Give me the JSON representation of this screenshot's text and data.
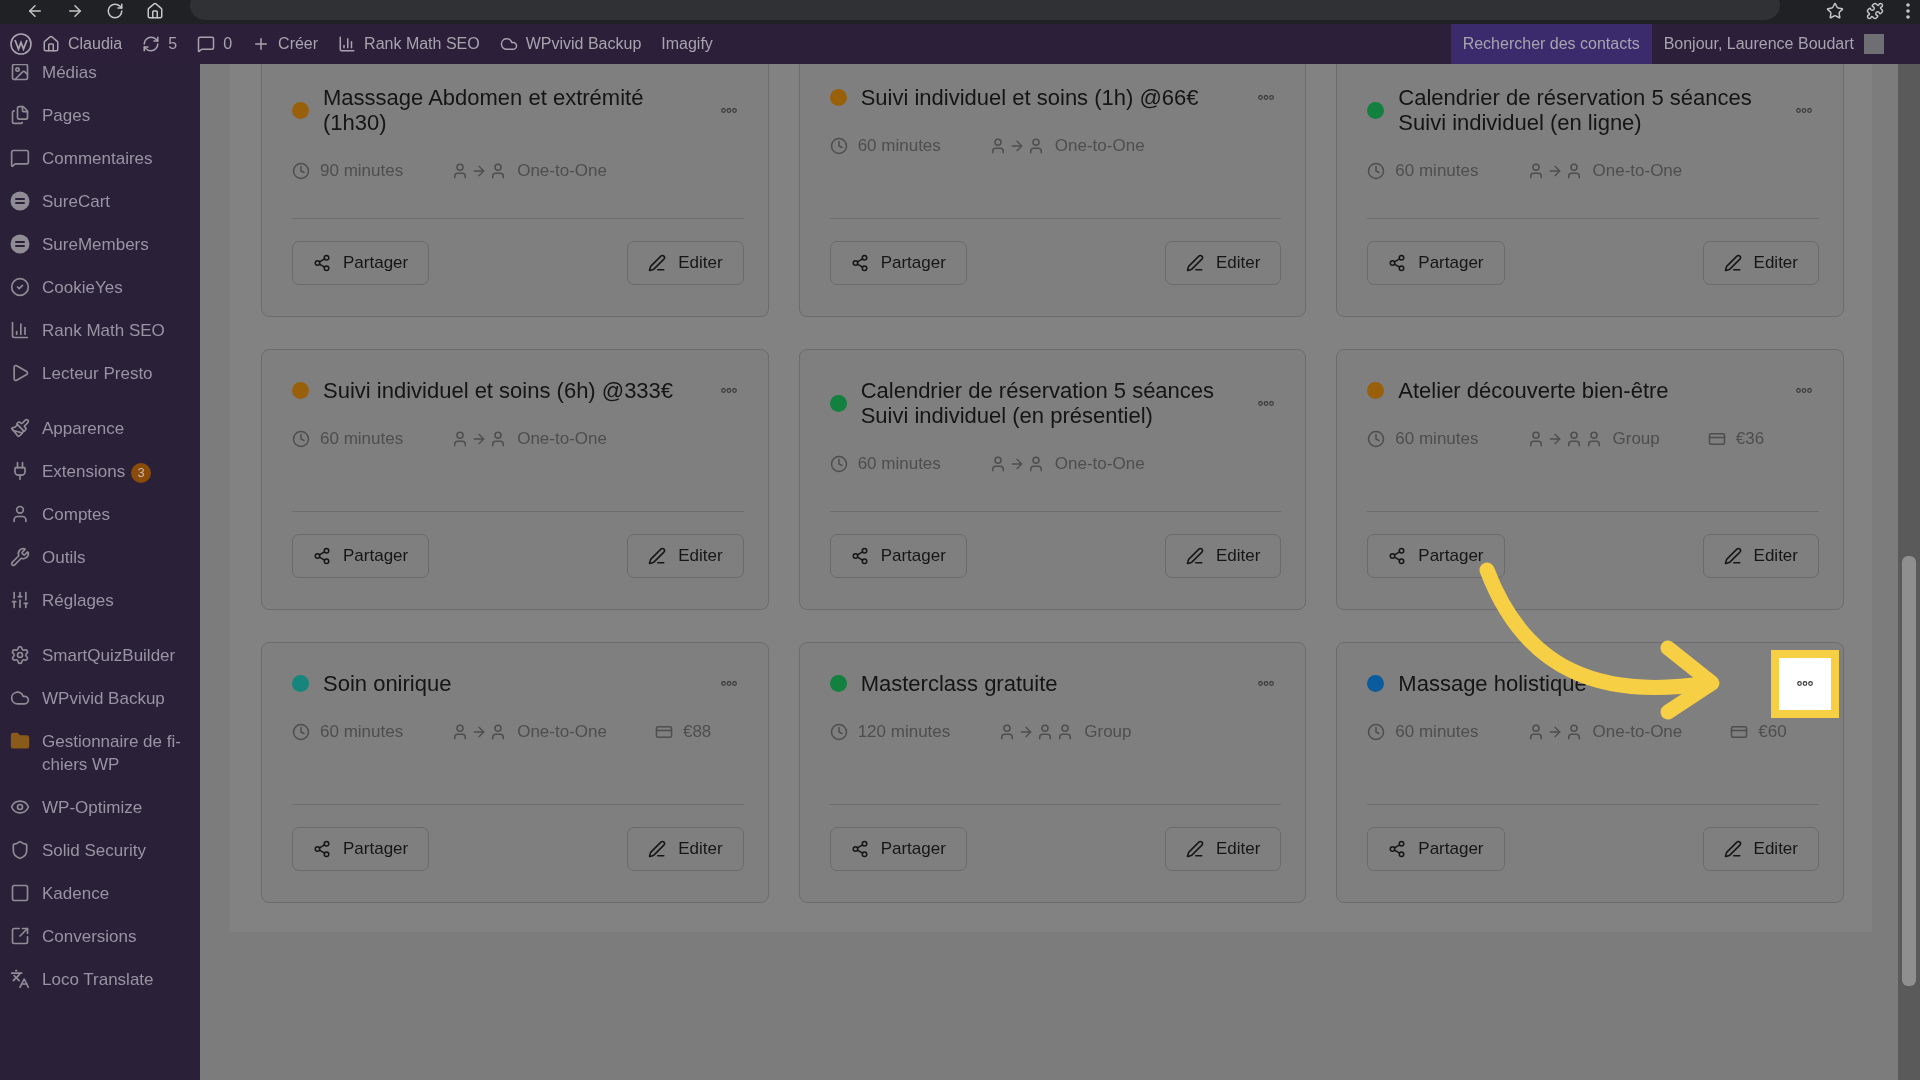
{
  "admin_bar": {
    "items": [
      {
        "label": "Claudia"
      },
      {
        "label": "5"
      },
      {
        "label": "0"
      },
      {
        "label": "Créer"
      },
      {
        "label": "Rank Math SEO"
      },
      {
        "label": "WPvivid Backup"
      },
      {
        "label": "Imagify"
      }
    ],
    "search_contacts": "Rechercher des contacts",
    "greeting": "Bonjour, Laurence Boudart"
  },
  "sidebar": {
    "groups": [
      [
        {
          "label": "Médias"
        },
        {
          "label": "Pages"
        },
        {
          "label": "Commentaires"
        },
        {
          "label": "SureCart"
        },
        {
          "label": "SureMembers"
        },
        {
          "label": "CookieYes"
        },
        {
          "label": "Rank Math SEO"
        },
        {
          "label": "Lecteur Presto"
        }
      ],
      [
        {
          "label": "Apparence"
        },
        {
          "label": "Extensions",
          "badge": "3"
        },
        {
          "label": "Comptes"
        },
        {
          "label": "Outils"
        },
        {
          "label": "Réglages"
        }
      ],
      [
        {
          "label": "SmartQuizBuilder"
        },
        {
          "label": "WPvivid Backup"
        },
        {
          "label": "Gestionnaire de fi-chiers WP"
        },
        {
          "label": "WP-Optimize"
        },
        {
          "label": "Solid Security"
        },
        {
          "label": "Kadence"
        },
        {
          "label": "Conversions"
        },
        {
          "label": "Loco Translate"
        }
      ]
    ]
  },
  "cards": [
    {
      "title": "Masssage Abdomen et extrémité (1h30)",
      "color": "#98600a",
      "duration": "90 minutes",
      "session": {
        "kind": "one-to-one",
        "label": "One-to-One"
      },
      "share": "Partager",
      "edit": "Editer",
      "menu_highlighted": false
    },
    {
      "title": "Suivi individuel et soins (1h) @66€",
      "color": "#98600a",
      "duration": "60 minutes",
      "session": {
        "kind": "one-to-one",
        "label": "One-to-One"
      },
      "share": "Partager",
      "edit": "Editer",
      "menu_highlighted": false
    },
    {
      "title": "Calendrier de réservation 5 séances Suivi individuel (en ligne)",
      "color": "#12803f",
      "duration": "60 minutes",
      "session": {
        "kind": "one-to-one",
        "label": "One-to-One"
      },
      "share": "Partager",
      "edit": "Editer",
      "menu_highlighted": false
    },
    {
      "title": "Suivi individuel et soins (6h) @333€",
      "color": "#98600a",
      "duration": "60 minutes",
      "session": {
        "kind": "one-to-one",
        "label": "One-to-One"
      },
      "share": "Partager",
      "edit": "Editer",
      "menu_highlighted": false
    },
    {
      "title": "Calendrier de réservation 5 séances Suivi individuel (en présentiel)",
      "color": "#12803f",
      "duration": "60 minutes",
      "session": {
        "kind": "one-to-one",
        "label": "One-to-One"
      },
      "share": "Partager",
      "edit": "Editer",
      "menu_highlighted": false
    },
    {
      "title": "Atelier découverte bien-être",
      "color": "#98600a",
      "duration": "60 minutes",
      "session": {
        "kind": "group",
        "label": "Group"
      },
      "price": "€36",
      "share": "Partager",
      "edit": "Editer",
      "menu_highlighted": false
    },
    {
      "title": "Soin onirique",
      "color": "#16867c",
      "duration": "60 minutes",
      "session": {
        "kind": "one-to-one",
        "label": "One-to-One"
      },
      "price": "€88",
      "share": "Partager",
      "edit": "Editer",
      "menu_highlighted": false
    },
    {
      "title": "Masterclass gratuite",
      "color": "#12803f",
      "duration": "120 minutes",
      "session": {
        "kind": "group",
        "label": "Group"
      },
      "share": "Partager",
      "edit": "Editer",
      "menu_highlighted": false
    },
    {
      "title": "Massage holistique",
      "color": "#0b5c9c",
      "duration": "60 minutes",
      "session": {
        "kind": "one-to-one",
        "label": "One-to-One"
      },
      "price": "€60",
      "share": "Partager",
      "edit": "Editer",
      "menu_highlighted": true
    }
  ]
}
